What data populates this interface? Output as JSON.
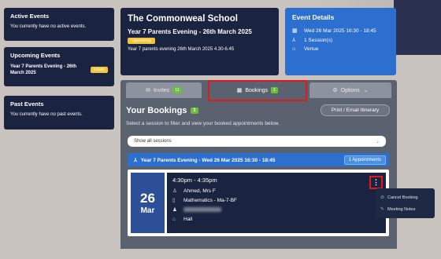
{
  "sidebar": {
    "active": {
      "title": "Active Events",
      "text": "You currently have no active events."
    },
    "upcoming": {
      "title": "Upcoming Events",
      "event": "Year 7 Parents Evening - 26th March 2025",
      "badge": "Future"
    },
    "past": {
      "title": "Past Events",
      "text": "You currently have no past events."
    }
  },
  "school": {
    "name": "The Commonweal School",
    "event_title": "Year 7 Parents Evening - 26th March 2025",
    "status_badge": "Upcoming",
    "event_sub": "Year 7 parents evening 26th March 2025 4.30-6.45"
  },
  "details": {
    "title": "Event Details",
    "datetime": "Wed 26 Mar 2025 16:30 - 18:45",
    "sessions": "1 Session(s)",
    "venue": "Venue"
  },
  "tabs": [
    {
      "label": "Invites",
      "count": "11"
    },
    {
      "label": "Bookings",
      "count": "1"
    },
    {
      "label": "Options",
      "chev": "⌄"
    }
  ],
  "bookings": {
    "title": "Your Bookings",
    "count": "1",
    "print_label": "Print / Email Itinerary",
    "hint": "Select a session to filter and view your booked appointments below.",
    "filter_value": "Show all sessions",
    "event_bar": "Year 7 Parents Evening - Wed 26 Mar 2025 16:30 - 18:45",
    "appointments_badge": "1 Appointments"
  },
  "booking": {
    "day": "26",
    "month": "Mar",
    "time": "4:30pm - 4:35pm",
    "teacher": "Ahmed, Mrs F",
    "subject": "Mathematics - Ma-7-BF",
    "room": "Hall"
  },
  "menu": {
    "items": [
      {
        "label": "Cancel Booking",
        "icon": "cancel-circle-icon"
      },
      {
        "label": "Meeting Notes",
        "icon": "edit-note-icon"
      }
    ]
  },
  "colors": {
    "navy": "#1a2440",
    "blue": "#2d6fcf",
    "panel": "#5a6270",
    "green": "#6bbf3b",
    "yellow": "#f3c43a",
    "highlight_red": "#e01a1a"
  }
}
